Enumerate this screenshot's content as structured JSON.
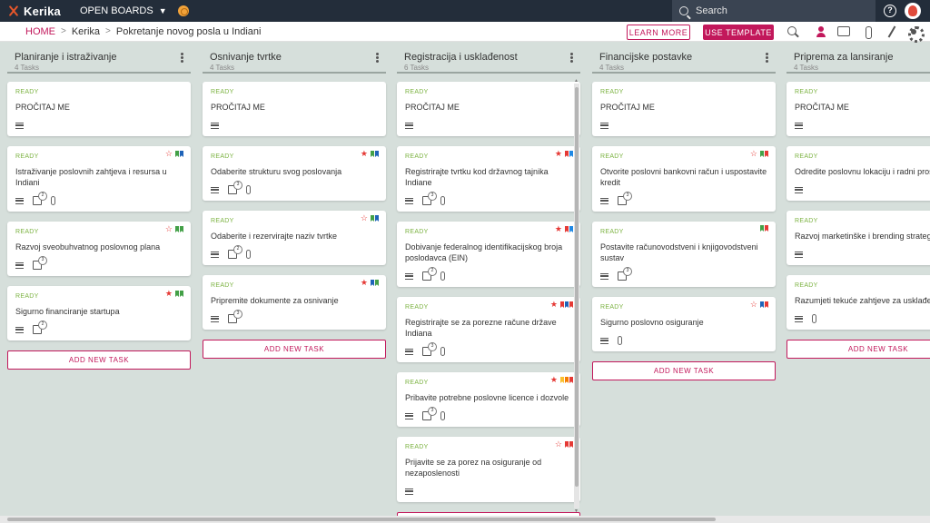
{
  "app": {
    "name": "Kerika",
    "open_boards": "OPEN BOARDS"
  },
  "search": {
    "placeholder": "Search"
  },
  "breadcrumb": {
    "home": "HOME",
    "account": "Kerika",
    "board": "Pokretanje novog posla u Indiani"
  },
  "toolbar": {
    "learn_more": "LEARN MORE",
    "use_template": "USE TEMPLATE"
  },
  "colors": {
    "accent": "#c2185b",
    "topbar": "#232d3a",
    "ready": "#7cb342",
    "board_bg": "#d6dfdb"
  },
  "columns": [
    {
      "title": "Planiranje i istraživanje",
      "count": "4 Tasks",
      "add_label": "ADD NEW TASK",
      "cards": [
        {
          "status": "READY",
          "title": "PROČITAJ ME",
          "desc": true,
          "check": null,
          "clip": false,
          "star": null,
          "flags": []
        },
        {
          "status": "READY",
          "title": "Istraživanje poslovnih zahtjeva i resursa u Indiani",
          "desc": true,
          "check": "2",
          "clip": true,
          "star": "outline",
          "flags": [
            "#43a047",
            "#1e63b8"
          ]
        },
        {
          "status": "READY",
          "title": "Razvoj sveobuhvatnog poslovnog plana",
          "desc": true,
          "check": "3",
          "clip": false,
          "star": "outline",
          "flags": [
            "#43a047",
            "#43a047"
          ]
        },
        {
          "status": "READY",
          "title": "Sigurno financiranje startupa",
          "desc": true,
          "check": "2",
          "clip": false,
          "star": "filled",
          "flags": [
            "#43a047",
            "#43a047"
          ]
        }
      ]
    },
    {
      "title": "Osnivanje tvrtke",
      "count": "4 Tasks",
      "add_label": "ADD NEW TASK",
      "cards": [
        {
          "status": "READY",
          "title": "PROČITAJ ME",
          "desc": true,
          "check": null,
          "clip": false,
          "star": null,
          "flags": []
        },
        {
          "status": "READY",
          "title": "Odaberite strukturu svog poslovanja",
          "desc": true,
          "check": "3",
          "clip": true,
          "star": "filled",
          "flags": [
            "#43a047",
            "#1e63b8"
          ]
        },
        {
          "status": "READY",
          "title": "Odaberite i rezervirajte naziv tvrtke",
          "desc": true,
          "check": "2",
          "clip": true,
          "star": "outline",
          "flags": [
            "#43a047",
            "#1e63b8"
          ]
        },
        {
          "status": "READY",
          "title": "Pripremite dokumente za osnivanje",
          "desc": true,
          "check": "3",
          "clip": false,
          "star": "filled",
          "flags": [
            "#1e63b8",
            "#43a047"
          ]
        }
      ]
    },
    {
      "title": "Registracija i usklađenost",
      "count": "6 Tasks",
      "add_label": "ADD NEW TASK",
      "cards": [
        {
          "status": "READY",
          "title": "PROČITAJ ME",
          "desc": true,
          "check": null,
          "clip": false,
          "star": null,
          "flags": []
        },
        {
          "status": "READY",
          "title": "Registrirajte tvrtku kod državnog tajnika Indiane",
          "desc": true,
          "check": "3",
          "clip": true,
          "star": "filled",
          "flags": [
            "#e53935",
            "#1e88e5"
          ]
        },
        {
          "status": "READY",
          "title": "Dobivanje federalnog identifikacijskog broja poslodavca (EIN)",
          "desc": true,
          "check": "2",
          "clip": true,
          "star": "filled",
          "flags": [
            "#e53935",
            "#1e88e5"
          ]
        },
        {
          "status": "READY",
          "title": "Registrirajte se za porezne račune države Indiana",
          "desc": true,
          "check": "3",
          "clip": true,
          "star": "filled",
          "flags": [
            "#e53935",
            "#1e63b8",
            "#e53935"
          ]
        },
        {
          "status": "READY",
          "title": "Pribavite potrebne poslovne licence i dozvole",
          "desc": true,
          "check": "3",
          "clip": true,
          "star": "filled",
          "flags": [
            "#fbc02d",
            "#f57c00",
            "#e53935"
          ]
        },
        {
          "status": "READY",
          "title": "Prijavite se za porez na osiguranje od nezaposlenosti",
          "desc": true,
          "check": null,
          "clip": false,
          "star": "outline",
          "flags": [
            "#e53935",
            "#e53935"
          ]
        }
      ]
    },
    {
      "title": "Financijske postavke",
      "count": "4 Tasks",
      "add_label": "ADD NEW TASK",
      "cards": [
        {
          "status": "READY",
          "title": "PROČITAJ ME",
          "desc": true,
          "check": null,
          "clip": false,
          "star": null,
          "flags": []
        },
        {
          "status": "READY",
          "title": "Otvorite poslovni bankovni račun i uspostavite kredit",
          "desc": true,
          "check": "3",
          "clip": false,
          "star": "outline",
          "flags": [
            "#43a047",
            "#e53935"
          ]
        },
        {
          "status": "READY",
          "title": "Postavite računovodstveni i knjigovodstveni sustav",
          "desc": true,
          "check": "3",
          "clip": false,
          "star": null,
          "flags": [
            "#43a047",
            "#e53935"
          ]
        },
        {
          "status": "READY",
          "title": "Sigurno poslovno osiguranje",
          "desc": true,
          "check": null,
          "clip": true,
          "star": "outline",
          "flags": [
            "#1e63b8",
            "#e53935"
          ]
        }
      ]
    },
    {
      "title": "Priprema za lansiranje",
      "count": "4 Tasks",
      "add_label": "ADD NEW TASK",
      "cards": [
        {
          "status": "READY",
          "title": "PROČITAJ ME",
          "desc": true,
          "check": null,
          "clip": false,
          "star": null,
          "flags": []
        },
        {
          "status": "READY",
          "title": "Odredite poslovnu lokaciju i radni prostor",
          "desc": true,
          "check": null,
          "clip": false,
          "star": null,
          "flags": []
        },
        {
          "status": "READY",
          "title": "Razvoj marketinške i brending strategije",
          "desc": true,
          "check": null,
          "clip": false,
          "star": null,
          "flags": []
        },
        {
          "status": "READY",
          "title": "Razumjeti tekuće zahtjeve za usklađenost",
          "desc": true,
          "check": null,
          "clip": true,
          "star": null,
          "flags": []
        }
      ]
    }
  ]
}
